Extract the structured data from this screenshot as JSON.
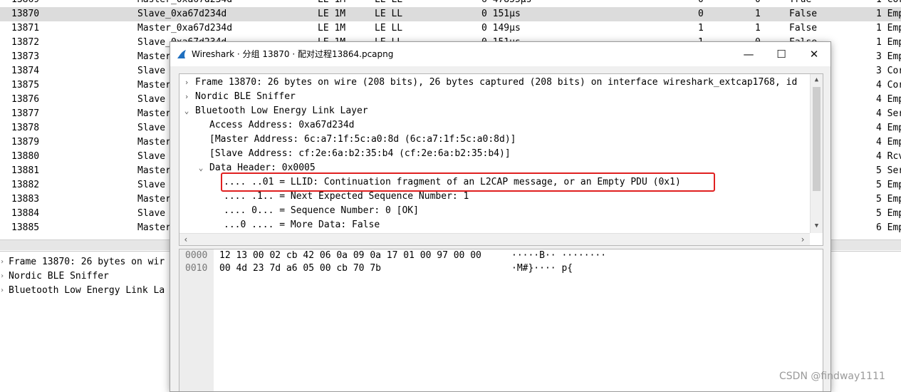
{
  "packet_list": {
    "rows": [
      {
        "no": "13869",
        "role": "Master_0xa67d234d",
        "phy": "LE 1M",
        "ll": "LE LL",
        "delta": "6 47855µs",
        "a": "0",
        "b": "0",
        "flag": "True",
        "info": "1 Cor"
      },
      {
        "no": "13870",
        "role": "Slave_0xa67d234d",
        "phy": "LE 1M",
        "ll": "LE LL",
        "delta": "0 151µs",
        "a": "0",
        "b": "1",
        "flag": "False",
        "info": "1 Emp"
      },
      {
        "no": "13871",
        "role": "Master_0xa67d234d",
        "phy": "LE 1M",
        "ll": "LE LL",
        "delta": "0 149µs",
        "a": "1",
        "b": "1",
        "flag": "False",
        "info": "1 Emp"
      },
      {
        "no": "13872",
        "role": "Slave_0xa67d234d",
        "phy": "LE 1M",
        "ll": "LE LL",
        "delta": "0 151µs",
        "a": "1",
        "b": "0",
        "flag": "False",
        "info": "1 Emp"
      },
      {
        "no": "13873",
        "role": "Master",
        "info": "3 Emp"
      },
      {
        "no": "13874",
        "role": "Slave",
        "info": "3 Cor"
      },
      {
        "no": "13875",
        "role": "Master",
        "info": "4 Cor"
      },
      {
        "no": "13876",
        "role": "Slave",
        "info": "4 Emp"
      },
      {
        "no": "13877",
        "role": "Master",
        "info": "4 Ser"
      },
      {
        "no": "13878",
        "role": "Slave",
        "info": "4 Emp"
      },
      {
        "no": "13879",
        "role": "Master",
        "info": "4 Emp"
      },
      {
        "no": "13880",
        "role": "Slave",
        "info": "4 Rcv"
      },
      {
        "no": "13881",
        "role": "Master",
        "info": "5 Ser"
      },
      {
        "no": "13882",
        "role": "Slave",
        "info": "5 Emp"
      },
      {
        "no": "13883",
        "role": "Master",
        "info": "5 Emp"
      },
      {
        "no": "13884",
        "role": "Slave",
        "info": "5 Emp"
      },
      {
        "no": "13885",
        "role": "Master",
        "info": "6 Emp"
      }
    ]
  },
  "bg_details": {
    "frame": "Frame 13870: 26 bytes on wir",
    "sniffer": "Nordic BLE Sniffer",
    "ble": "Bluetooth Low Energy Link La"
  },
  "dialog": {
    "title": "Wireshark · 分组 13870 · 配对过程13864.pcapng",
    "min_glyph": "—",
    "max_glyph": "☐",
    "close_glyph": "✕",
    "tree": {
      "frame": "Frame 13870: 26 bytes on wire (208 bits), 26 bytes captured (208 bits) on interface wireshark_extcap1768, id",
      "nordic": "Nordic BLE Sniffer",
      "ble": "Bluetooth Low Energy Link Layer",
      "access": "Access Address: 0xa67d234d",
      "master": "[Master Address: 6c:a7:1f:5c:a0:8d (6c:a7:1f:5c:a0:8d)]",
      "slave": "[Slave Address: cf:2e:6a:b2:35:b4 (cf:2e:6a:b2:35:b4)]",
      "data_header": "Data Header: 0x0005",
      "llid": ".... ..01 = LLID: Continuation fragment of an L2CAP message, or an Empty PDU (0x1)",
      "nesn": ".... .1.. = Next Expected Sequence Number: 1",
      "sn": ".... 0... = Sequence Number: 0 [OK]",
      "md": "...0 .... = More Data: False"
    },
    "bytes": [
      {
        "offset": "0000",
        "hex": "12 13 00 02 cb 42 06 0a  09 0a 17 01 00 97 00 00",
        "ascii": "·····B·· ········"
      },
      {
        "offset": "0010",
        "hex": "00 4d 23 7d a6 05 00 cb  70 7b",
        "ascii": "·M#}···· p{"
      }
    ]
  },
  "watermark": "CSDN @findway1111",
  "colors": {
    "highlight": "#e02020",
    "selected_row": "#dcdcdc"
  }
}
